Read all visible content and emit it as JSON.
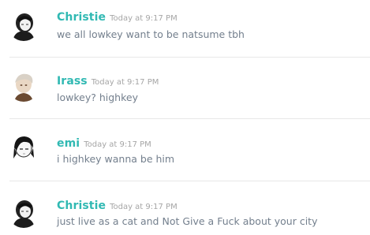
{
  "colors": {
    "username": "#31b9b3",
    "timestamp": "#a6a6a6",
    "message": "#737f8d",
    "divider": "#e8e8e8"
  },
  "messages": [
    {
      "author": "Christie",
      "timestamp": "Today at 9:17 PM",
      "text": "we all lowkey want to be natsume tbh",
      "avatar": "christie-avatar"
    },
    {
      "author": "Irass",
      "timestamp": "Today at 9:17 PM",
      "text": "lowkey? highkey",
      "avatar": "irass-avatar"
    },
    {
      "author": "emi",
      "timestamp": "Today at 9:17 PM",
      "text": "i highkey wanna be him",
      "avatar": "emi-avatar"
    },
    {
      "author": "Christie",
      "timestamp": "Today at 9:17 PM",
      "text": "just live as a cat and Not Give a Fuck about your city",
      "avatar": "christie-avatar"
    }
  ]
}
